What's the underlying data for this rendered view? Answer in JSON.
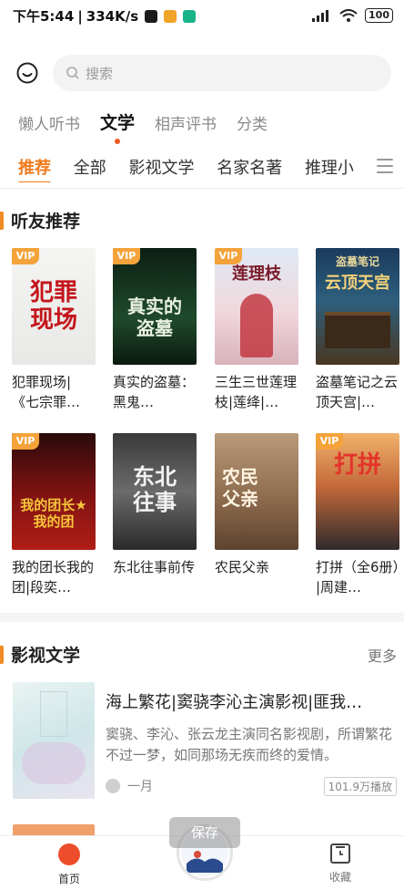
{
  "status_bar": {
    "time": "下午5:44",
    "speed": "334K/s",
    "battery": "100",
    "app_icon_colors": [
      "#1b1b1b",
      "#f0a428",
      "#19b38a"
    ]
  },
  "search": {
    "placeholder": "搜索"
  },
  "top_tabs": [
    {
      "label": "懒人听书",
      "active": false
    },
    {
      "label": "文学",
      "active": true
    },
    {
      "label": "相声评书",
      "active": false
    },
    {
      "label": "分类",
      "active": false
    }
  ],
  "sub_tabs": [
    {
      "label": "推荐",
      "active": true
    },
    {
      "label": "全部",
      "active": false
    },
    {
      "label": "影视文学",
      "active": false
    },
    {
      "label": "名家名著",
      "active": false
    },
    {
      "label": "推理小",
      "active": false
    }
  ],
  "listener_recommend": {
    "title": "听友推荐",
    "books": [
      {
        "title": "犯罪现场|《七宗罪…",
        "vip": true,
        "cover_text": "犯罪现场"
      },
      {
        "title": "真实的盗墓：黑鬼…",
        "vip": true,
        "cover_text": "真实的盗墓"
      },
      {
        "title": "三生三世莲理枝|莲绛|…",
        "vip": true,
        "cover_text": "莲理枝"
      },
      {
        "title": "盗墓笔记之云顶天宫|…",
        "vip": false,
        "cover_text": "云顶天宫"
      },
      {
        "title": "我的团长我的团|段奕…",
        "vip": true,
        "cover_text": "我的团长我的团"
      },
      {
        "title": "东北往事前传",
        "vip": false,
        "cover_text": "东北往事"
      },
      {
        "title": "农民父亲",
        "vip": false,
        "cover_text": "农民父亲"
      },
      {
        "title": "打拼（全6册）|周建…",
        "vip": true,
        "cover_text": "打拼"
      }
    ]
  },
  "film_literature": {
    "title": "影视文学",
    "more": "更多",
    "featured": {
      "title": "海上繁花|窦骁李沁主演影视|匪我…",
      "description": "窦骁、李沁、张云龙主演同名影视剧，所谓繁花不过一梦，如同那场无疾而终的爱情。",
      "author": "一月",
      "plays": "101.9万播放"
    }
  },
  "toast": {
    "text": "保存"
  },
  "bottom_nav": {
    "home_label": "首页",
    "favorites_label": "收藏"
  },
  "colors": {
    "accent": "#f07a1a",
    "vip_badge": "#f4a33b",
    "home_icon": "#ee4d2b"
  },
  "vip_label": "VIP"
}
